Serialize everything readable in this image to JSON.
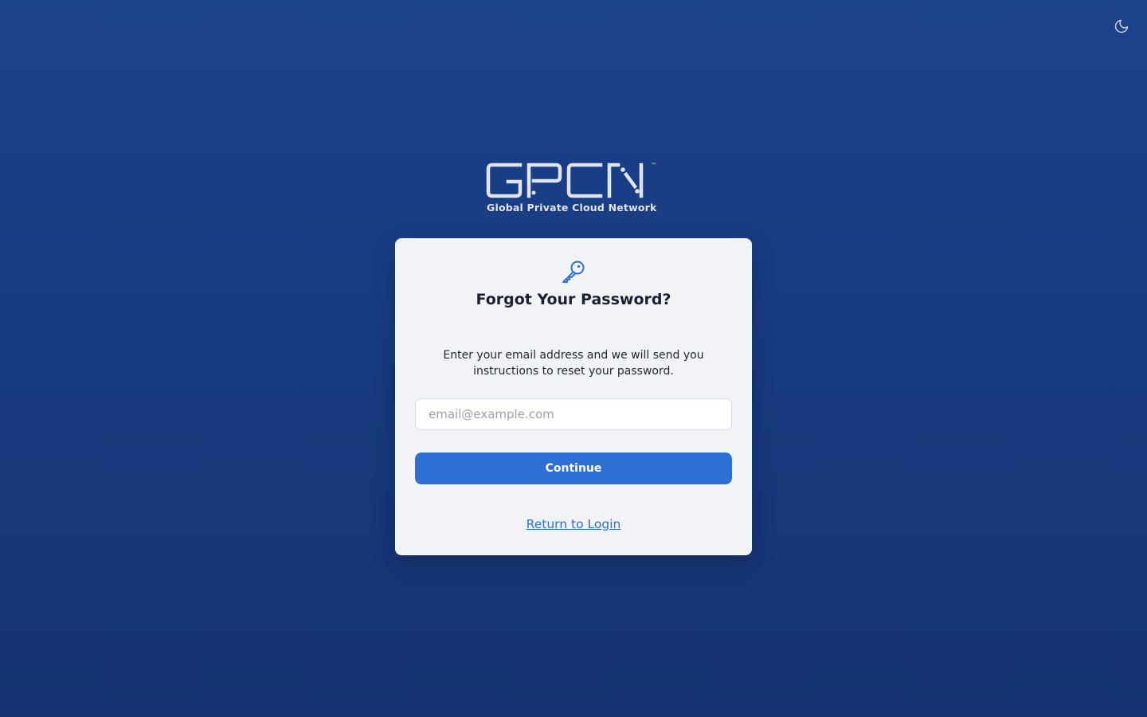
{
  "header": {
    "theme_toggle_icon": "moon-icon"
  },
  "logo": {
    "name": "GPCN",
    "trademark": "™",
    "tagline": "Global Private Cloud Network"
  },
  "card": {
    "icon": "key-icon",
    "title": "Forgot Your Password?",
    "description": "Enter your email address and we will send you instructions to reset your password.",
    "email": {
      "value": "",
      "placeholder": "email@example.com"
    },
    "continue_label": "Continue",
    "return_label": "Return to Login"
  },
  "colors": {
    "background_top": "#1c428b",
    "background_bottom": "#153371",
    "card_background": "#f1f3f7",
    "accent": "#2e6fd6",
    "logo": "#dfe4ee"
  }
}
